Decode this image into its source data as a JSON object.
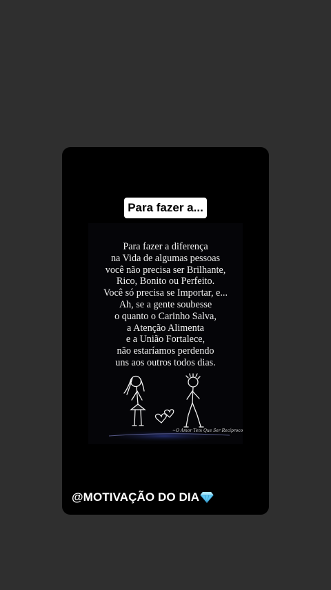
{
  "story": {
    "title_sticker": "Para fazer a...",
    "quote_lines": [
      "Para fazer a diferença",
      "na Vida de algumas pessoas",
      "você não precisa ser Brilhante,",
      "Rico, Bonito ou Perfeito.",
      "Você só precisa se Importar, e...",
      "Ah, se a gente soubesse",
      "o quanto o Carinho Salva,",
      "a Atenção Alimenta",
      "e a União Fortalece,",
      "não estaríamos perdendo",
      "uns aos outros todos dias."
    ],
    "image_signature": "~O Amor Tem Que Ser Recíproco",
    "caption": "@MOTIVAÇÃO DO DIA",
    "caption_icon": "gem-icon",
    "colors": {
      "page_background": "#2f2f2f",
      "card_background": "#000000",
      "sticker_background": "#ffffff",
      "text": "#ffffff",
      "gem": "#5ec8f2"
    }
  }
}
